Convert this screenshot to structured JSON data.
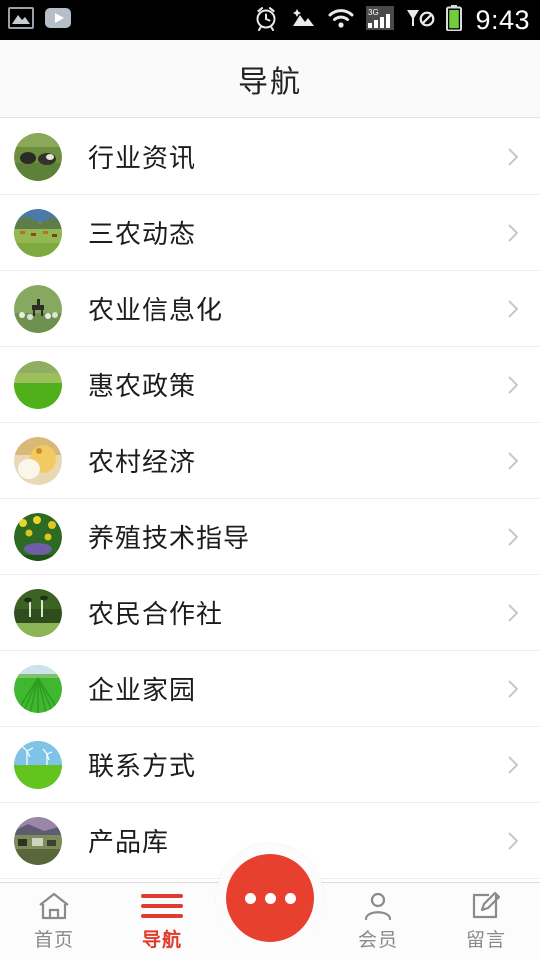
{
  "statusbar": {
    "time": "9:43",
    "left_icons": [
      "gallery-icon",
      "play-video-icon"
    ],
    "right_icons": [
      "alarm-clock-icon",
      "screenshot-icon",
      "wifi-icon",
      "signal-3g-icon",
      "no-sim-icon",
      "battery-icon"
    ],
    "signal_label": "3G",
    "background": "#000000"
  },
  "header": {
    "title": "导航"
  },
  "list": {
    "items": [
      {
        "label": "行业资讯",
        "thumb": "cows-pasture"
      },
      {
        "label": "三农动态",
        "thumb": "cattle-valley"
      },
      {
        "label": "农业信息化",
        "thumb": "herder-horse"
      },
      {
        "label": "惠农政策",
        "thumb": "green-meadow"
      },
      {
        "label": "农村经济",
        "thumb": "chick-egg"
      },
      {
        "label": "养殖技术指导",
        "thumb": "flower-field"
      },
      {
        "label": "农民合作社",
        "thumb": "sprouts-dark"
      },
      {
        "label": "企业家园",
        "thumb": "crop-rows"
      },
      {
        "label": "联系方式",
        "thumb": "wind-turbines"
      },
      {
        "label": "产品库",
        "thumb": "village-dusk"
      }
    ],
    "chevron": "chevron-right-icon"
  },
  "tabbar": {
    "active_color": "#e03b2c",
    "inactive_color": "#8a8a8a",
    "fab_color": "#e8402f",
    "items": [
      {
        "label": "首页",
        "icon": "home-icon",
        "active": false
      },
      {
        "label": "导航",
        "icon": "menu-bars-icon",
        "active": true
      },
      {
        "label": "会员",
        "icon": "user-icon",
        "active": false
      },
      {
        "label": "留言",
        "icon": "edit-message-icon",
        "active": false
      }
    ],
    "fab": {
      "icon": "more-dots-icon"
    }
  }
}
